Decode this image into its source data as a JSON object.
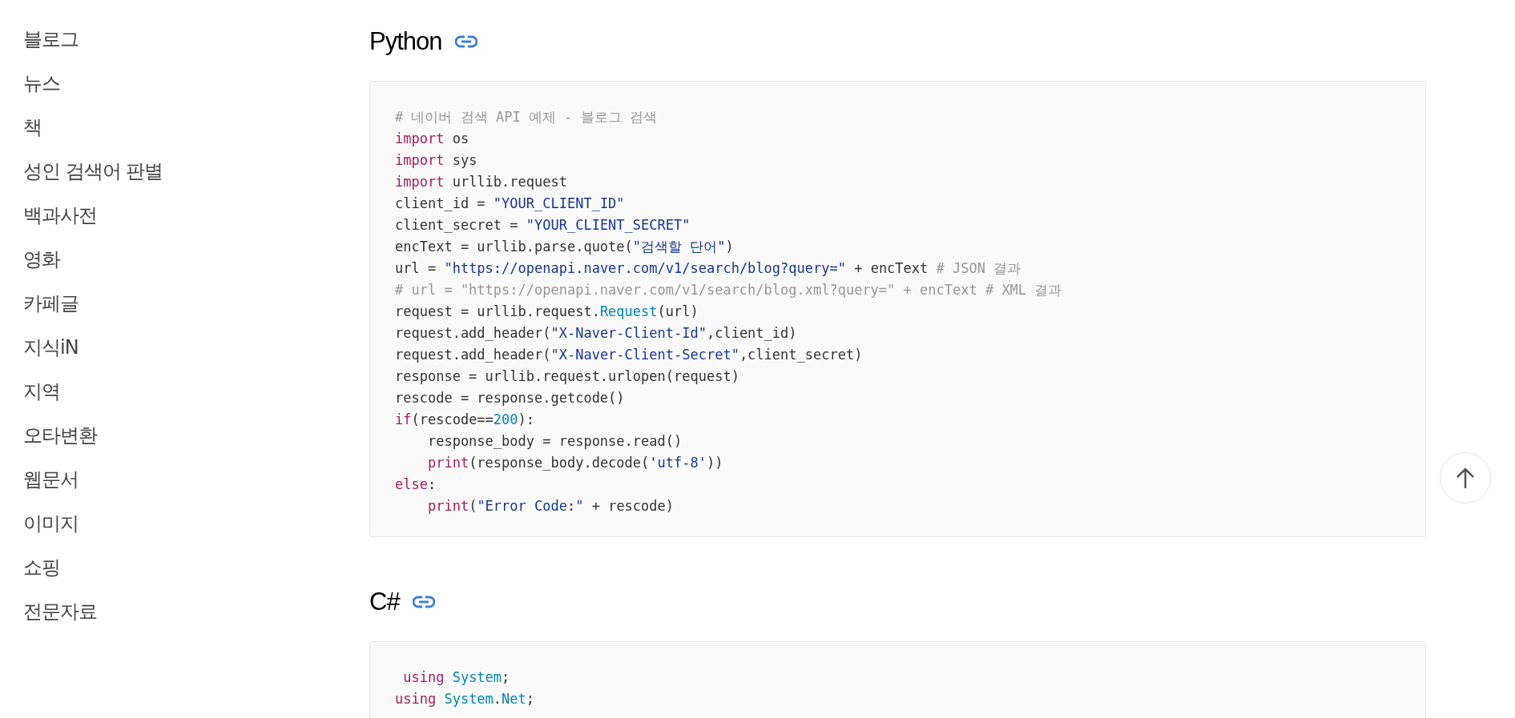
{
  "sidebar": {
    "items": [
      {
        "label": "블로그"
      },
      {
        "label": "뉴스"
      },
      {
        "label": "책"
      },
      {
        "label": "성인 검색어 판별"
      },
      {
        "label": "백과사전"
      },
      {
        "label": "영화"
      },
      {
        "label": "카페글"
      },
      {
        "label": "지식iN"
      },
      {
        "label": "지역"
      },
      {
        "label": "오타변환"
      },
      {
        "label": "웹문서"
      },
      {
        "label": "이미지"
      },
      {
        "label": "쇼핑"
      },
      {
        "label": "전문자료"
      }
    ]
  },
  "sections": [
    {
      "title": "Python",
      "code": [
        [
          {
            "kind": "comment",
            "text": "# 네이버 검색 API 예제 - 블로그 검색"
          }
        ],
        [
          {
            "kind": "keyword",
            "text": "import"
          },
          {
            "kind": "plain",
            "text": " os"
          }
        ],
        [
          {
            "kind": "keyword",
            "text": "import"
          },
          {
            "kind": "plain",
            "text": " sys"
          }
        ],
        [
          {
            "kind": "keyword",
            "text": "import"
          },
          {
            "kind": "plain",
            "text": " urllib.request"
          }
        ],
        [
          {
            "kind": "plain",
            "text": "client_id = "
          },
          {
            "kind": "string",
            "text": "\"YOUR_CLIENT_ID\""
          }
        ],
        [
          {
            "kind": "plain",
            "text": "client_secret = "
          },
          {
            "kind": "string",
            "text": "\"YOUR_CLIENT_SECRET\""
          }
        ],
        [
          {
            "kind": "plain",
            "text": "encText = urllib.parse.quote("
          },
          {
            "kind": "string",
            "text": "\"검색할 단어\""
          },
          {
            "kind": "plain",
            "text": ")"
          }
        ],
        [
          {
            "kind": "plain",
            "text": "url = "
          },
          {
            "kind": "string",
            "text": "\"https://openapi.naver.com/v1/search/blog?query=\""
          },
          {
            "kind": "plain",
            "text": " + encText "
          },
          {
            "kind": "comment",
            "text": "# JSON 결과"
          }
        ],
        [
          {
            "kind": "comment",
            "text": "# url = \"https://openapi.naver.com/v1/search/blog.xml?query=\" + encText # XML 결과"
          }
        ],
        [
          {
            "kind": "plain",
            "text": "request = urllib.request."
          },
          {
            "kind": "builtin",
            "text": "Request"
          },
          {
            "kind": "plain",
            "text": "(url)"
          }
        ],
        [
          {
            "kind": "plain",
            "text": "request.add_header("
          },
          {
            "kind": "string",
            "text": "\"X-Naver-Client-Id\""
          },
          {
            "kind": "plain",
            "text": ",client_id)"
          }
        ],
        [
          {
            "kind": "plain",
            "text": "request.add_header("
          },
          {
            "kind": "string",
            "text": "\"X-Naver-Client-Secret\""
          },
          {
            "kind": "plain",
            "text": ",client_secret)"
          }
        ],
        [
          {
            "kind": "plain",
            "text": "response = urllib.request.urlopen(request)"
          }
        ],
        [
          {
            "kind": "plain",
            "text": "rescode = response.getcode()"
          }
        ],
        [
          {
            "kind": "keyword",
            "text": "if"
          },
          {
            "kind": "plain",
            "text": "(rescode=="
          },
          {
            "kind": "builtin",
            "text": "200"
          },
          {
            "kind": "plain",
            "text": "):"
          }
        ],
        [
          {
            "kind": "plain",
            "text": "    response_body = response.read()"
          }
        ],
        [
          {
            "kind": "keyword",
            "text": "    print"
          },
          {
            "kind": "plain",
            "text": "(response_body.decode("
          },
          {
            "kind": "string",
            "text": "'utf-8'"
          },
          {
            "kind": "plain",
            "text": "))"
          }
        ],
        [
          {
            "kind": "keyword",
            "text": "else"
          },
          {
            "kind": "plain",
            "text": ":"
          }
        ],
        [
          {
            "kind": "keyword",
            "text": "    print"
          },
          {
            "kind": "plain",
            "text": "("
          },
          {
            "kind": "string",
            "text": "\"Error Code:\""
          },
          {
            "kind": "plain",
            "text": " + rescode)"
          }
        ]
      ]
    },
    {
      "title": "C#",
      "code": [
        [
          {
            "kind": "keyword",
            "text": " using "
          },
          {
            "kind": "builtin",
            "text": "System"
          },
          {
            "kind": "plain",
            "text": ";"
          }
        ],
        [
          {
            "kind": "keyword",
            "text": "using "
          },
          {
            "kind": "builtin",
            "text": "System"
          },
          {
            "kind": "plain",
            "text": "."
          },
          {
            "kind": "builtin",
            "text": "Net"
          },
          {
            "kind": "plain",
            "text": ";"
          }
        ]
      ]
    }
  ]
}
